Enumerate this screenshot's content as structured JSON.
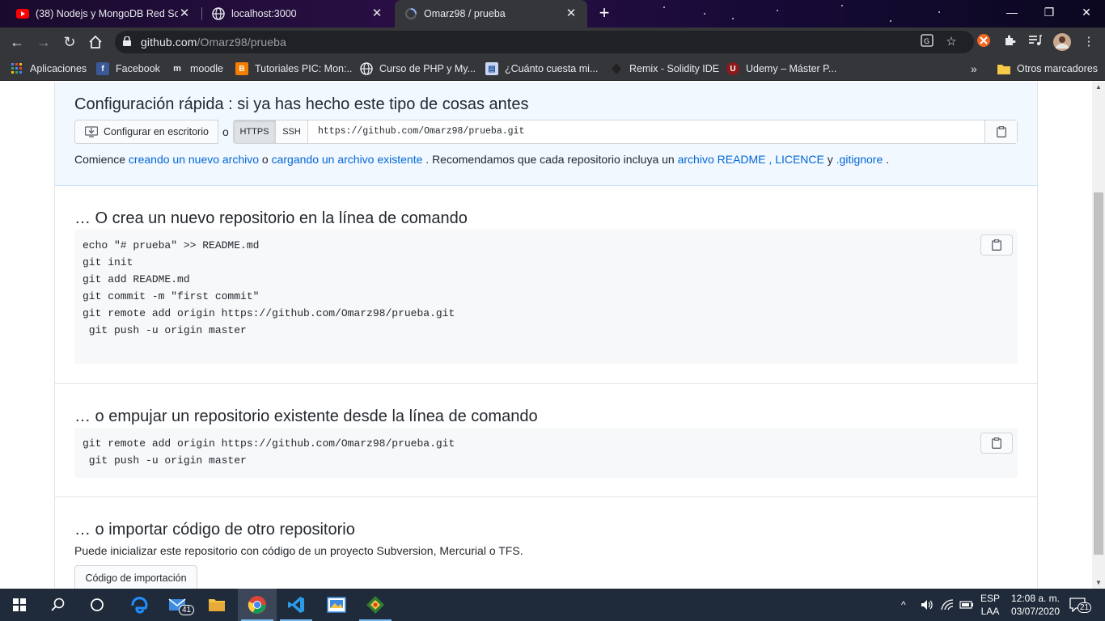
{
  "browser": {
    "tabs": [
      {
        "title": "(38) Nodejs y MongoDB Red Soc",
        "icon": "youtube-icon"
      },
      {
        "title": "localhost:3000",
        "icon": "globe-icon"
      },
      {
        "title": "Omarz98 / prueba",
        "icon": "loading-icon",
        "active": true
      }
    ],
    "url_host": "github.com",
    "url_path": "/Omarz98/prueba",
    "bookmarks": [
      {
        "label": "Aplicaciones",
        "icon": "apps-grid-icon"
      },
      {
        "label": "Facebook",
        "icon": "facebook-icon"
      },
      {
        "label": "moodle",
        "icon": "moodle-icon"
      },
      {
        "label": "Tutoriales PIC: Mon:..",
        "icon": "blogger-icon"
      },
      {
        "label": "Curso de PHP y My...",
        "icon": "globe-icon"
      },
      {
        "label": "¿Cuánto cuesta mi...",
        "icon": "document-icon"
      },
      {
        "label": "Remix - Solidity IDE",
        "icon": "remix-icon"
      },
      {
        "label": "Udemy – Máster P...",
        "icon": "udemy-icon"
      }
    ],
    "other_bookmarks": "Otros marcadores"
  },
  "quick_setup": {
    "title": "Configuración rápida : si ya has hecho este tipo de cosas antes",
    "desktop_button": "Configurar en escritorio",
    "or": "o",
    "https": "HTTPS",
    "ssh": "SSH",
    "clone_url": "https://github.com/Omarz98/prueba.git",
    "desc_start": "Comience",
    "link_new_file": "creando un nuevo archivo",
    "desc_or": "o",
    "link_upload": "cargando un archivo existente",
    "desc_mid": ". Recomendamos que cada repositorio incluya un",
    "link_readme": "archivo README",
    "comma": ",",
    "link_license": "LICENCE",
    "desc_y": "y",
    "link_gitignore": ".gitignore",
    "period": "."
  },
  "new_repo": {
    "title": "… O crea un nuevo repositorio en la línea de comando",
    "lines": [
      "echo \"# prueba\" >> README.md",
      "git init",
      "git add README.md",
      "git commit -m \"first commit\"",
      "git remote add origin https://github.com/Omarz98/prueba.git",
      " git push -u origin master"
    ]
  },
  "push_repo": {
    "title": "… o empujar un repositorio existente desde la línea de comando",
    "lines": [
      "git remote add origin https://github.com/Omarz98/prueba.git",
      " git push -u origin master"
    ]
  },
  "import_repo": {
    "title": "… o importar código de otro repositorio",
    "desc": "Puede inicializar este repositorio con código de un proyecto Subversion, Mercurial o TFS.",
    "button": "Código de importación"
  },
  "taskbar": {
    "mail_badge": "41",
    "lang_top": "ESP",
    "lang_bottom": "LAA",
    "time": "12:08 a. m.",
    "date": "03/07/2020",
    "notif_count": "21"
  }
}
